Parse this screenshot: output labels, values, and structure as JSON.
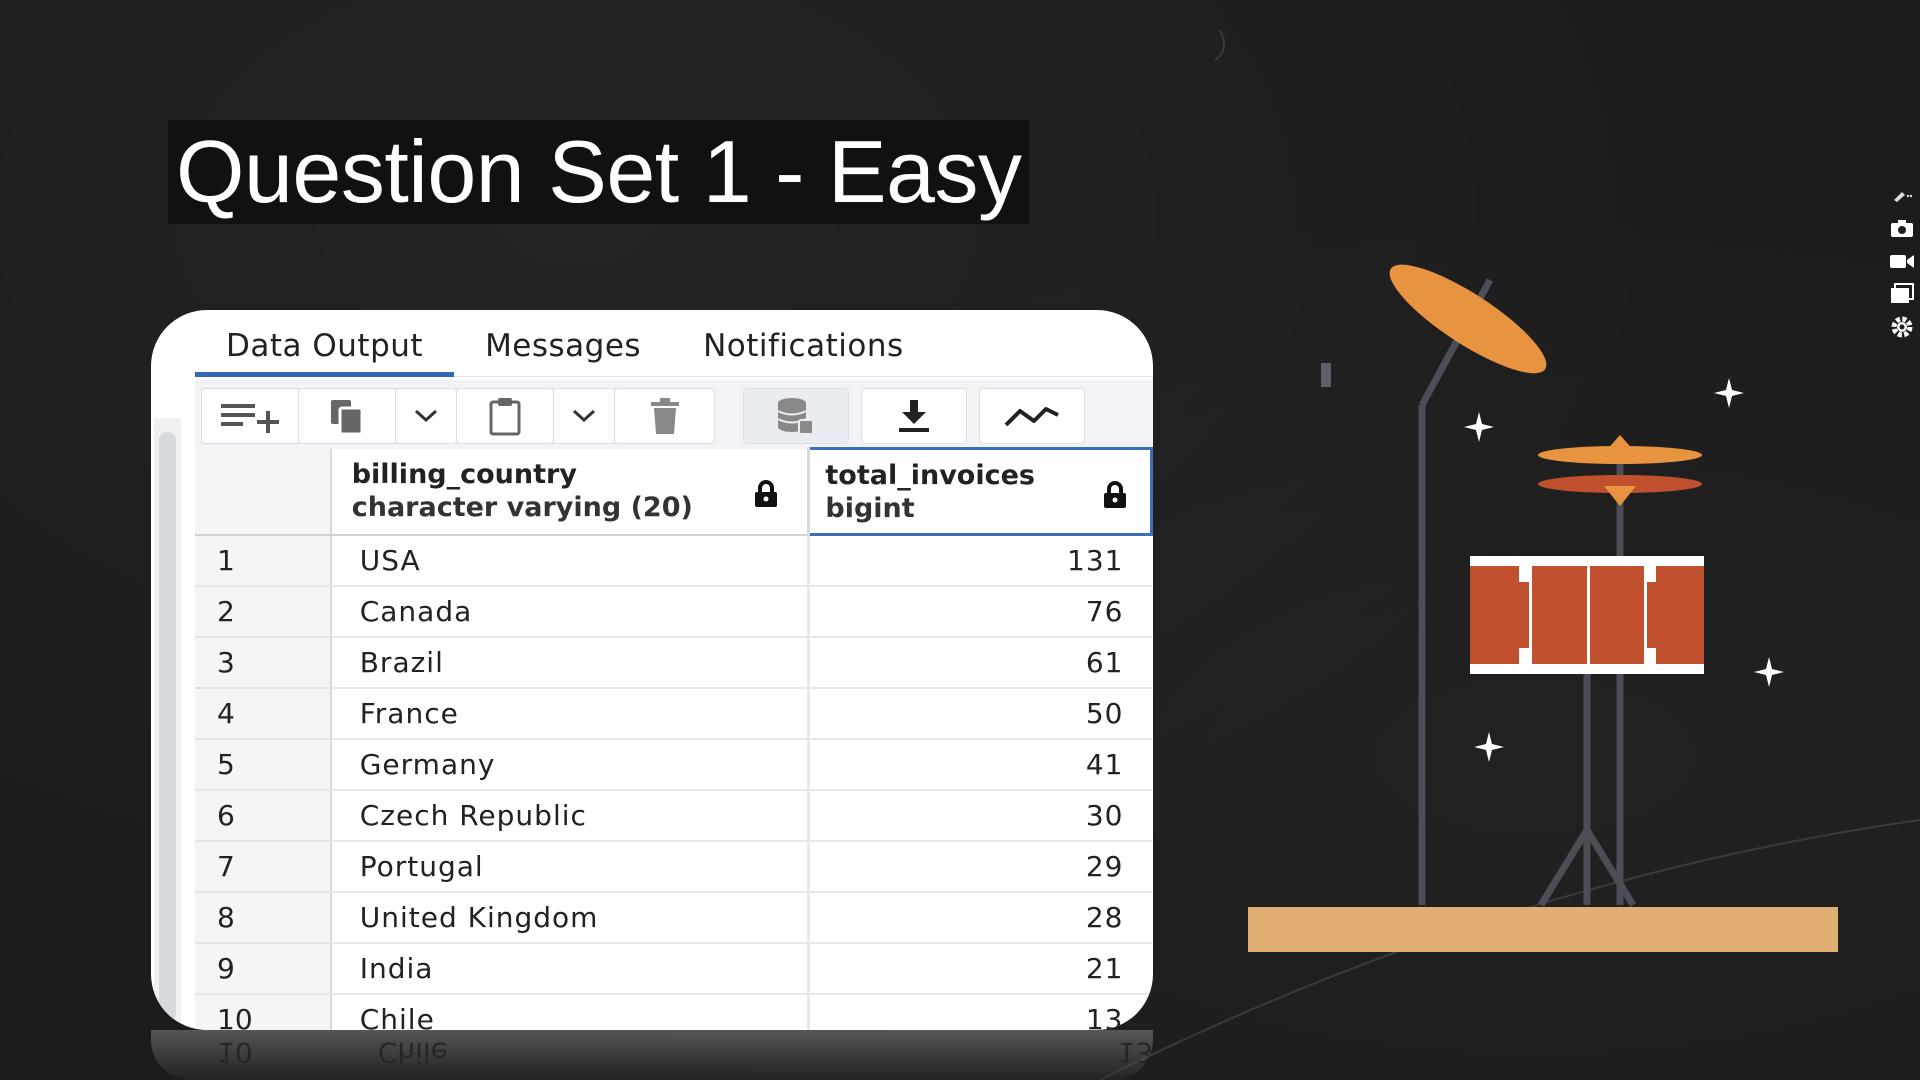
{
  "slide": {
    "title": "Question Set 1 - Easy"
  },
  "tabs": [
    {
      "label": "Data Output",
      "active": true
    },
    {
      "label": "Messages",
      "active": false
    },
    {
      "label": "Notifications",
      "active": false
    }
  ],
  "toolbar": {
    "icons": [
      "add-row-icon",
      "copy-icon",
      "chevron-down-icon",
      "paste-icon",
      "chevron-down-icon",
      "delete-icon",
      "save-data-icon",
      "download-icon",
      "graph-icon"
    ]
  },
  "columns": [
    {
      "name": "billing_country",
      "type": "character varying (20)"
    },
    {
      "name": "total_invoices",
      "type": "bigint"
    }
  ],
  "rows": [
    {
      "n": "1",
      "country": "USA",
      "total": "131"
    },
    {
      "n": "2",
      "country": "Canada",
      "total": "76"
    },
    {
      "n": "3",
      "country": "Brazil",
      "total": "61"
    },
    {
      "n": "4",
      "country": "France",
      "total": "50"
    },
    {
      "n": "5",
      "country": "Germany",
      "total": "41"
    },
    {
      "n": "6",
      "country": "Czech Republic",
      "total": "30"
    },
    {
      "n": "7",
      "country": "Portugal",
      "total": "29"
    },
    {
      "n": "8",
      "country": "United Kingdom",
      "total": "28"
    },
    {
      "n": "9",
      "country": "India",
      "total": "21"
    },
    {
      "n": "10",
      "country": "Chile",
      "total": "13"
    }
  ],
  "reflection": {
    "n": "10",
    "country": "Chile",
    "total": "13"
  },
  "colors": {
    "accent": "#3c6fb4",
    "cymbal": "#e8933f",
    "drum": "#c1502f",
    "floor": "#e1ae74",
    "background": "#1c1c1c"
  }
}
